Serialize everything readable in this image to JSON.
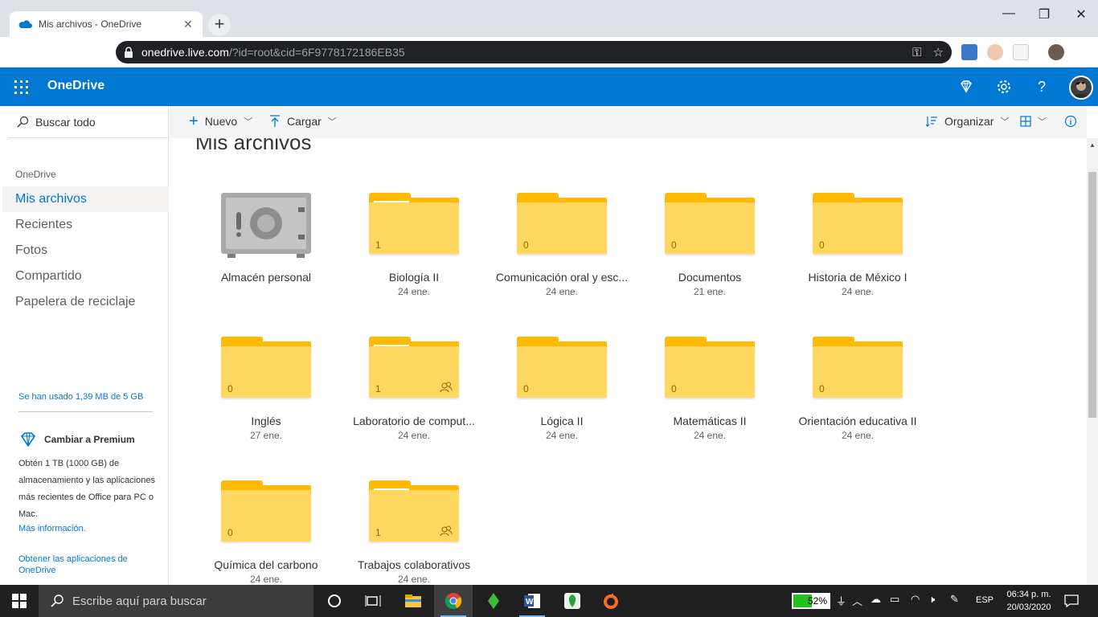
{
  "browser": {
    "tab_title": "Mis archivos - OneDrive",
    "url_host": "onedrive.live.com",
    "url_rest": "/?id=root&cid=6F9778172186EB35"
  },
  "header": {
    "brand": "OneDrive"
  },
  "nav": {
    "search": "Buscar todo",
    "section": "OneDrive",
    "items": [
      {
        "label": "Mis archivos",
        "selected": true
      },
      {
        "label": "Recientes"
      },
      {
        "label": "Fotos"
      },
      {
        "label": "Compartido"
      },
      {
        "label": "Papelera de reciclaje"
      }
    ],
    "quota": "Se han usado 1,39 MB de 5 GB",
    "premium_title": "Cambiar a Premium",
    "premium_body": "Obtén 1 TB (1000 GB) de almacenamiento y las aplicaciones más recientes de Office para PC o Mac.",
    "premium_more": "Más información.",
    "get_apps": "Obtener las aplicaciones de OneDrive"
  },
  "commands": {
    "new": "Nuevo",
    "upload": "Cargar",
    "sort": "Organizar"
  },
  "page_title": "Mis archivos",
  "tiles": [
    {
      "name": "Almacén personal",
      "date": "",
      "type": "vault"
    },
    {
      "name": "Biología II",
      "date": "24 ene.",
      "count": "1",
      "has_paper": true
    },
    {
      "name": "Comunicación oral y esc...",
      "date": "24 ene.",
      "count": "0"
    },
    {
      "name": "Documentos",
      "date": "21 ene.",
      "count": "0"
    },
    {
      "name": "Historia de México I",
      "date": "24 ene.",
      "count": "0"
    },
    {
      "name": "Inglés",
      "date": "27 ene.",
      "count": "0"
    },
    {
      "name": "Laboratorio de comput...",
      "date": "24 ene.",
      "count": "1",
      "has_paper": true,
      "shared": true
    },
    {
      "name": "Lógica II",
      "date": "24 ene.",
      "count": "0"
    },
    {
      "name": "Matemáticas II",
      "date": "24 ene.",
      "count": "0"
    },
    {
      "name": "Orientación educativa II",
      "date": "24 ene.",
      "count": "0"
    },
    {
      "name": "Química del carbono",
      "date": "24 ene.",
      "count": "0"
    },
    {
      "name": "Trabajos colaborativos",
      "date": "24 ene.",
      "count": "1",
      "has_paper": true,
      "shared": true
    }
  ],
  "taskbar": {
    "search_placeholder": "Escribe aquí para buscar",
    "battery": "52%",
    "battery_level": 0.52,
    "lang": "ESP",
    "time": "06:34 p. m.",
    "date": "20/03/2020"
  },
  "colors": {
    "accent": "#0078d4",
    "folder": "#ffd75e",
    "folder_back": "#ffb900"
  }
}
